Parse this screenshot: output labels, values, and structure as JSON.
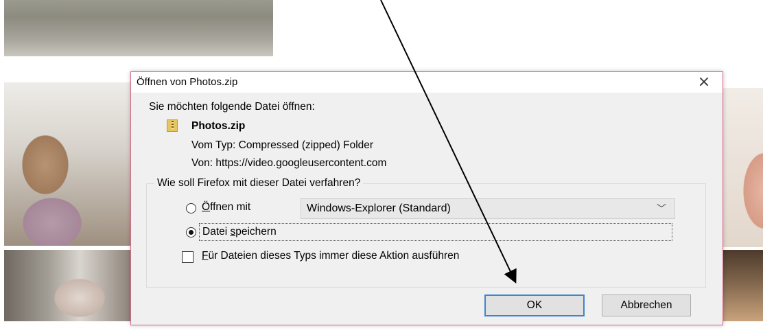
{
  "dialog": {
    "title": "Öffnen von Photos.zip",
    "close_symbol": "×",
    "prompt": "Sie möchten folgende Datei öffnen:",
    "file": {
      "icon": "zip-folder-icon",
      "name": "Photos.zip",
      "type_line": "Vom Typ: Compressed (zipped) Folder",
      "from_line": "Von: https://video.googleusercontent.com"
    },
    "action_group": {
      "label": "Wie soll Firefox mit dieser Datei verfahren?",
      "open_with": {
        "label_accel": "Ö",
        "label_rest": "ffnen mit",
        "checked": false,
        "app": "Windows-Explorer (Standard)"
      },
      "save_file": {
        "label_pre": "Datei ",
        "label_accel": "s",
        "label_rest": "peichern",
        "checked": true
      },
      "always": {
        "label_accel": "F",
        "label_rest": "ür Dateien dieses Typs immer diese Aktion ausführen",
        "checked": false
      }
    },
    "buttons": {
      "ok": "OK",
      "cancel": "Abbrechen"
    }
  },
  "colors": {
    "dialog_border": "#d56a8a",
    "ok_focus": "#3c86d0",
    "dialog_bg": "#f0f0f0"
  }
}
